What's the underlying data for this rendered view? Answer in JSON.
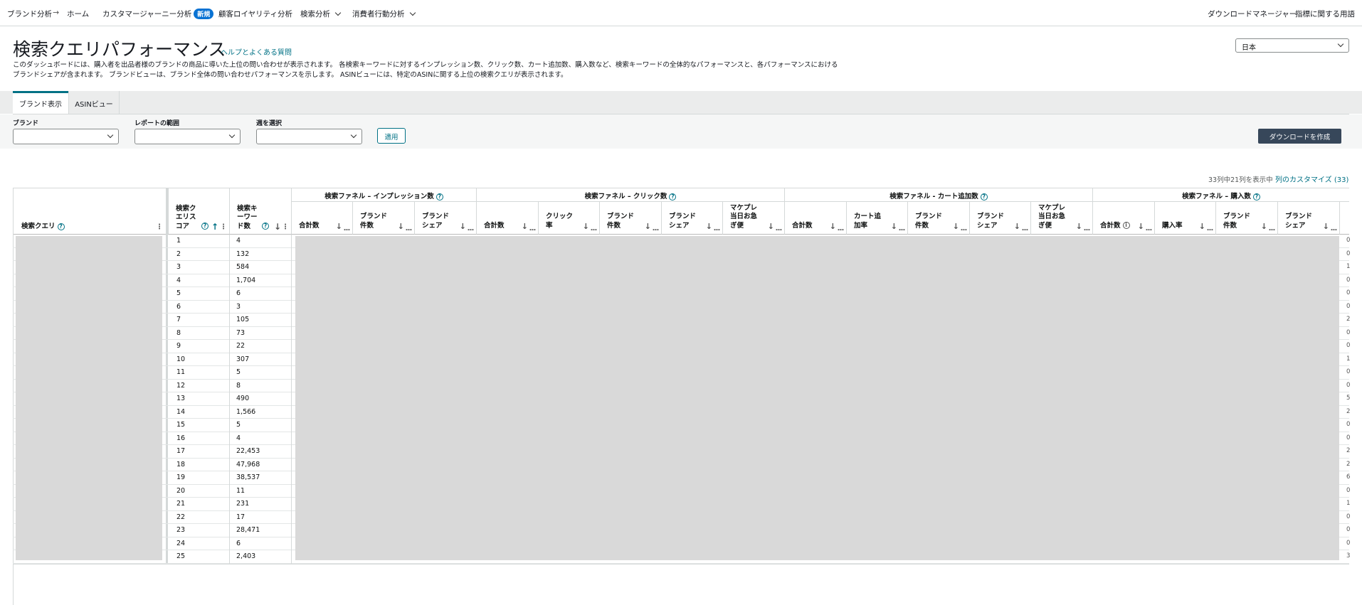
{
  "nav": {
    "brand_analytics": "ブランド分析",
    "home": "ホーム",
    "customer_journey": "カスタマージャーニー分析",
    "new_badge": "新規",
    "loyalty": "顧客ロイヤリティ分析",
    "search_analytics": "検索分析",
    "consumer_behavior": "消費者行動分析",
    "download_manager": "ダウンロードマネージャー",
    "glossary": "指標に関する用語"
  },
  "header": {
    "title": "検索クエリパフォーマンス",
    "help_link": "ヘルプとよくある質問",
    "description_1": "このダッシュボードには、購入者を出品者様のブランドの商品に導いた上位の問い合わせが表示されます。 各検索キーワードに対するインプレッション数、クリック数、カート追加数、購入数など、検索キーワードの全体的なパフォーマンスと、各パフォーマンスにおける",
    "description_2": "ブランドシェアが含まれます。 ブランドビューは、ブランド全体の問い合わせパフォーマンスを示します。 ASINビューには、特定のASINに関する上位の検索クエリが表示されます。",
    "country": "日本"
  },
  "tabs": [
    "ブランド表示",
    "ASINビュー"
  ],
  "filters": {
    "brand_label": "ブランド",
    "range_label": "レポートの範囲",
    "week_label": "週を選択",
    "apply": "適用",
    "download": "ダウンロードを作成"
  },
  "table_meta": {
    "column_count": "33列中21列を表示中",
    "customize": "列のカスタマイズ (33)"
  },
  "groups": {
    "impressions": "検索ファネル – インプレッション数",
    "clicks": "検索ファネル – クリック数",
    "cart": "検索ファネル - カート追加数",
    "purchases": "検索ファネル – 購入数"
  },
  "columns": {
    "query": "検索クエリ",
    "score": [
      "検索ク",
      "エリス",
      "コア"
    ],
    "volume": [
      "検索キ",
      "ーワー",
      "ド数"
    ],
    "total": "合計数",
    "click_rate": [
      "クリック",
      "率"
    ],
    "cart_rate": [
      "カート追",
      "加率"
    ],
    "purchase_rate": "購入率",
    "brand_count": [
      "ブランド",
      "件数"
    ],
    "brand_share": [
      "ブランド",
      "シェア"
    ],
    "same_day": [
      "マケプレ",
      "当日お急",
      "ぎ便"
    ]
  },
  "rows": [
    {
      "score": "1",
      "volume": "4",
      "tail": "0"
    },
    {
      "score": "2",
      "volume": "132",
      "tail": "0"
    },
    {
      "score": "3",
      "volume": "584",
      "tail": "1"
    },
    {
      "score": "4",
      "volume": "1,704",
      "tail": "0"
    },
    {
      "score": "5",
      "volume": "6",
      "tail": "0"
    },
    {
      "score": "6",
      "volume": "3",
      "tail": "0"
    },
    {
      "score": "7",
      "volume": "105",
      "tail": "2"
    },
    {
      "score": "8",
      "volume": "73",
      "tail": "0"
    },
    {
      "score": "9",
      "volume": "22",
      "tail": "0"
    },
    {
      "score": "10",
      "volume": "307",
      "tail": "1"
    },
    {
      "score": "11",
      "volume": "5",
      "tail": "0"
    },
    {
      "score": "12",
      "volume": "8",
      "tail": "0"
    },
    {
      "score": "13",
      "volume": "490",
      "tail": "5"
    },
    {
      "score": "14",
      "volume": "1,566",
      "tail": "2"
    },
    {
      "score": "15",
      "volume": "5",
      "tail": "0"
    },
    {
      "score": "16",
      "volume": "4",
      "tail": "0"
    },
    {
      "score": "17",
      "volume": "22,453",
      "tail": "2"
    },
    {
      "score": "18",
      "volume": "47,968",
      "tail": "2"
    },
    {
      "score": "19",
      "volume": "38,537",
      "tail": "6"
    },
    {
      "score": "20",
      "volume": "11",
      "tail": "0"
    },
    {
      "score": "21",
      "volume": "231",
      "tail": "1"
    },
    {
      "score": "22",
      "volume": "17",
      "tail": "0"
    },
    {
      "score": "23",
      "volume": "28,471",
      "tail": "0"
    },
    {
      "score": "24",
      "volume": "6",
      "tail": "0"
    },
    {
      "score": "25",
      "volume": "2,403",
      "tail": "3"
    }
  ]
}
